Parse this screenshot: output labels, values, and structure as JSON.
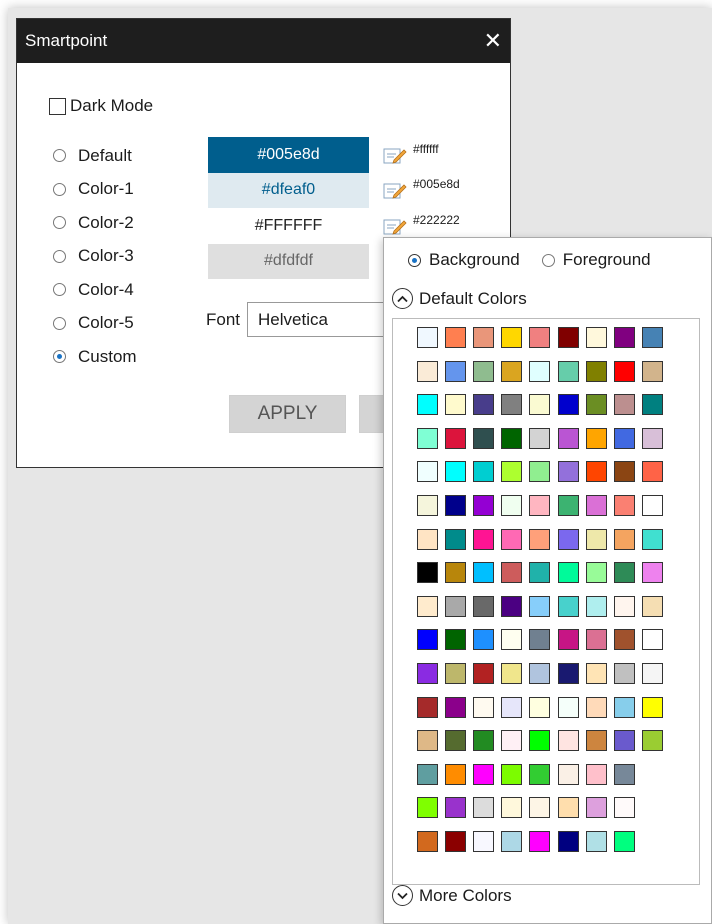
{
  "dialog": {
    "title": "Smartpoint",
    "close_label": "✕",
    "dark_mode_label": "Dark Mode",
    "themes": [
      {
        "label": "Default",
        "selected": false
      },
      {
        "label": "Color-1",
        "selected": false
      },
      {
        "label": "Color-2",
        "selected": false
      },
      {
        "label": "Color-3",
        "selected": false
      },
      {
        "label": "Color-4",
        "selected": false
      },
      {
        "label": "Color-5",
        "selected": false
      },
      {
        "label": "Custom",
        "selected": true
      }
    ],
    "swatches": [
      {
        "label": "#005e8d",
        "bg": "#005e8d",
        "fg": "#ffffff"
      },
      {
        "label": "#dfeaf0",
        "bg": "#dfeaf0",
        "fg": "#005e8d"
      },
      {
        "label": "#FFFFFF",
        "bg": "#ffffff",
        "fg": "#222222"
      },
      {
        "label": "#dfdfdf",
        "bg": "#dfdfdf",
        "fg": "#666666"
      }
    ],
    "edit_values": [
      "#ffffff",
      "#005e8d",
      "#222222"
    ],
    "font_label": "Font",
    "font_value": "Helvetica",
    "apply_label": "APPLY"
  },
  "color_picker": {
    "background_label": "Background",
    "foreground_label": "Foreground",
    "background_selected": true,
    "default_colors_label": "Default Colors",
    "more_colors_label": "More Colors",
    "colors": [
      [
        "#f0f8ff",
        "#ff7f50",
        "#e9967a",
        "#ffd700",
        "#f08080",
        "#800000",
        "#fff8dc",
        "#800080",
        "#4682b4"
      ],
      [
        "#faebd7",
        "#6495ed",
        "#8fbc8f",
        "#daa520",
        "#e0ffff",
        "#66cdaa",
        "#808000",
        "#ff0000",
        "#d2b48c"
      ],
      [
        "#00ffff",
        "#fffacd",
        "#483d8b",
        "#808080",
        "#fafad2",
        "#0000cd",
        "#6b8e23",
        "#bc8f8f",
        "#008080"
      ],
      [
        "#7fffd4",
        "#dc143c",
        "#2f4f4f",
        "#006400",
        "#d3d3d3",
        "#ba55d3",
        "#ffa500",
        "#4169e1",
        "#d8bfd8"
      ],
      [
        "#f0ffff",
        "#00ffff",
        "#00ced1",
        "#adff2f",
        "#90ee90",
        "#9370db",
        "#ff4500",
        "#8b4513",
        "#ff6347"
      ],
      [
        "#f5f5dc",
        "#00008b",
        "#9400d3",
        "#f0fff0",
        "#ffb6c1",
        "#3cb371",
        "#da70d6",
        "#fa8072",
        "#ffffff"
      ],
      [
        "#ffe4c4",
        "#008b8b",
        "#ff1493",
        "#ff69b4",
        "#ffa07a",
        "#7b68ee",
        "#eee8aa",
        "#f4a460",
        "#40e0d0"
      ],
      [
        "#000000",
        "#b8860b",
        "#00bfff",
        "#cd5c5c",
        "#20b2aa",
        "#00fa9a",
        "#98fb98",
        "#2e8b57",
        "#ee82ee"
      ],
      [
        "#ffebcd",
        "#a9a9a9",
        "#696969",
        "#4b0082",
        "#87cefa",
        "#48d1cc",
        "#afeeee",
        "#fff5ee",
        "#f5deb3"
      ],
      [
        "#0000ff",
        "#006400",
        "#1e90ff",
        "#fffff0",
        "#708090",
        "#c71585",
        "#db7093",
        "#a0522d",
        "#ffffff"
      ],
      [
        "#8a2be2",
        "#bdb76b",
        "#b22222",
        "#f0e68c",
        "#b0c4de",
        "#191970",
        "#ffe4b5",
        "#c0c0c0",
        "#f5f5f5"
      ],
      [
        "#a52a2a",
        "#8b008b",
        "#fffaf0",
        "#e6e6fa",
        "#ffffe0",
        "#f5fffa",
        "#ffdab9",
        "#87ceeb",
        "#ffff00"
      ],
      [
        "#deb887",
        "#556b2f",
        "#228b22",
        "#fff0f5",
        "#00ff00",
        "#ffe4e1",
        "#cd853f",
        "#6a5acd",
        "#9acd32"
      ],
      [
        "#5f9ea0",
        "#ff8c00",
        "#ff00ff",
        "#7cfc00",
        "#32cd32",
        "#faf0e6",
        "#ffc0cb",
        "#778899"
      ],
      [
        "#7fff00",
        "#9932cc",
        "#dcdcdc",
        "#fff8dc",
        "#fdf5e6",
        "#ffdead",
        "#dda0dd",
        "#fffafa"
      ],
      [
        "#d2691e",
        "#8b0000",
        "#f8f8ff",
        "#add8e6",
        "#ff00ff",
        "#000080",
        "#b0e0e6",
        "#00ff7f"
      ]
    ]
  }
}
